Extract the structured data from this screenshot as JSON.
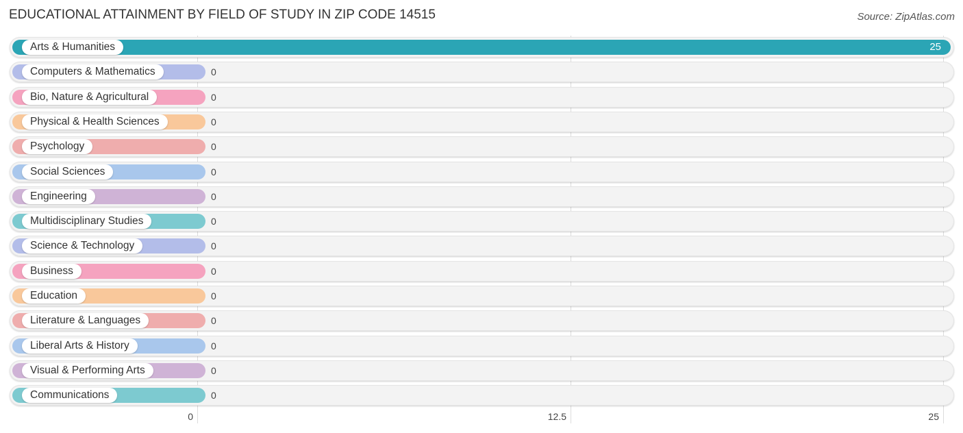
{
  "header": {
    "title": "EDUCATIONAL ATTAINMENT BY FIELD OF STUDY IN ZIP CODE 14515",
    "source": "Source: ZipAtlas.com"
  },
  "chart_data": {
    "type": "bar",
    "orientation": "horizontal",
    "title": "EDUCATIONAL ATTAINMENT BY FIELD OF STUDY IN ZIP CODE 14515",
    "source": "Source: ZipAtlas.com",
    "xlabel": "",
    "ylabel": "",
    "xlim": [
      0,
      25
    ],
    "x_ticks": [
      "0",
      "12.5",
      "25"
    ],
    "grid": true,
    "categories": [
      "Arts & Humanities",
      "Computers & Mathematics",
      "Bio, Nature & Agricultural",
      "Physical & Health Sciences",
      "Psychology",
      "Social Sciences",
      "Engineering",
      "Multidisciplinary Studies",
      "Science & Technology",
      "Business",
      "Education",
      "Literature & Languages",
      "Liberal Arts & History",
      "Visual & Performing Arts",
      "Communications"
    ],
    "values": [
      25,
      0,
      0,
      0,
      0,
      0,
      0,
      0,
      0,
      0,
      0,
      0,
      0,
      0,
      0
    ],
    "value_labels": [
      "25",
      "0",
      "0",
      "0",
      "0",
      "0",
      "0",
      "0",
      "0",
      "0",
      "0",
      "0",
      "0",
      "0",
      "0"
    ],
    "colors": [
      "#2ba5b5",
      "#b3bde9",
      "#f5a3bf",
      "#f9c89b",
      "#efadad",
      "#a9c7ec",
      "#cfb3d6",
      "#7dcad0",
      "#b3bde9",
      "#f5a3bf",
      "#f9c89b",
      "#efadad",
      "#a9c7ec",
      "#cfb3d6",
      "#7dcad0"
    ]
  }
}
